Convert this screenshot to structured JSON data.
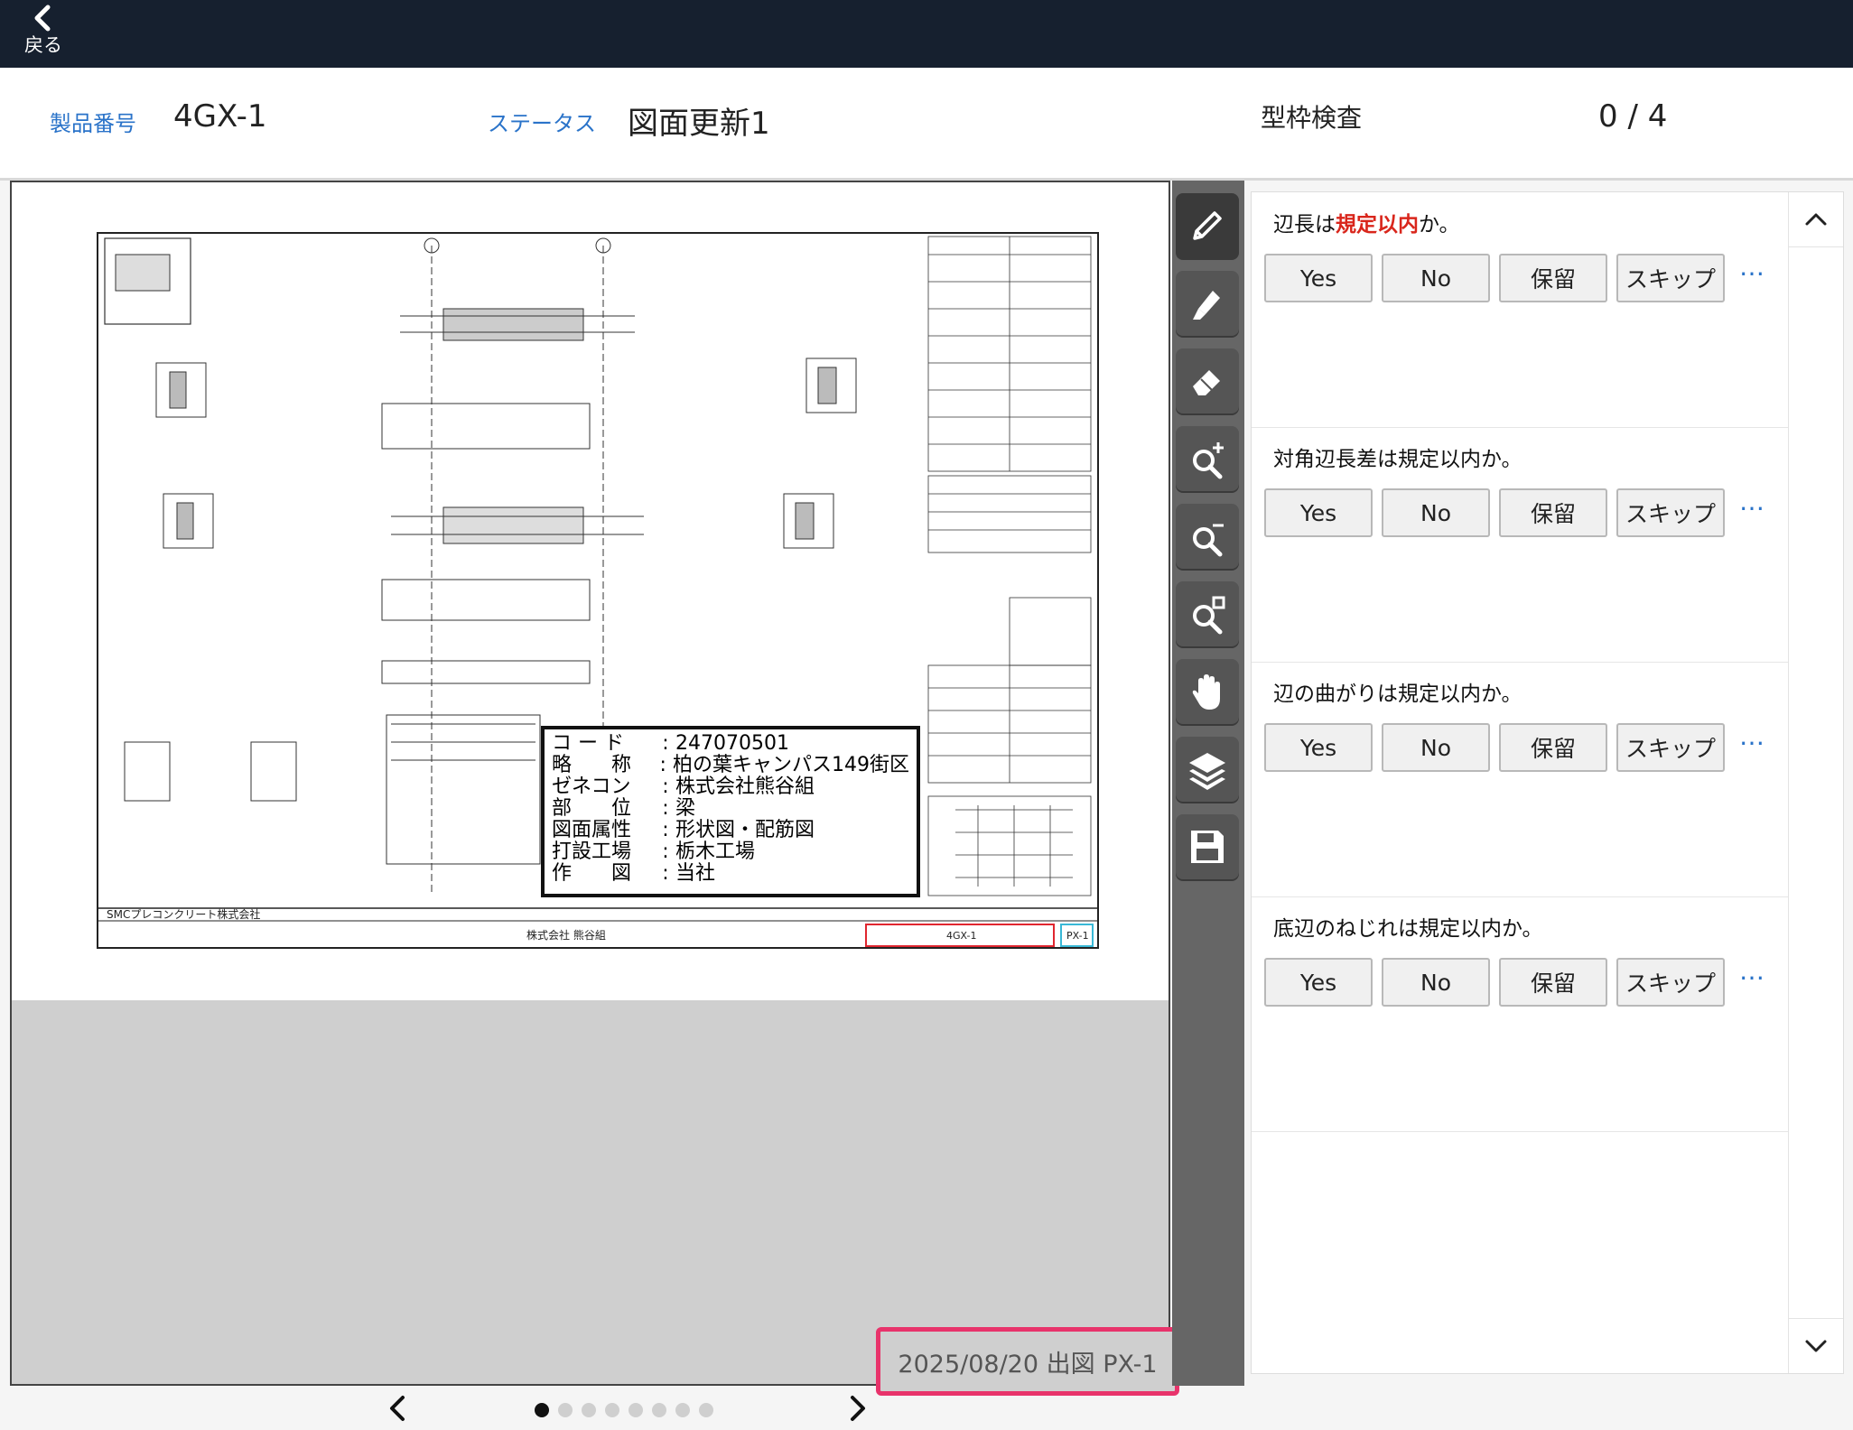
{
  "nav": {
    "back_label": "戻る"
  },
  "header": {
    "product_label": "製品番号",
    "product_value": "4GX-1",
    "status_label": "ステータス",
    "status_value": "図面更新1",
    "inspection_label": "型枠検査",
    "inspection_progress": "0 / 4"
  },
  "drawing": {
    "info": [
      {
        "key": "コ ー ド",
        "value": "247070501"
      },
      {
        "key": "略　　称",
        "value": "柏の葉キャンパス149街区"
      },
      {
        "key": "ゼネコン",
        "value": "株式会社熊谷組"
      },
      {
        "key": "部　　位",
        "value": "梁"
      },
      {
        "key": "図面属性",
        "value": "形状図・配筋図"
      },
      {
        "key": "打設工場",
        "value": "栃木工場"
      },
      {
        "key": "作　　図",
        "value": "当社"
      }
    ],
    "company_stamp": "SMCプレコンクリート株式会社",
    "contractor_stamp": "株式会社 熊谷組",
    "drawing_no": "4GX-1",
    "sheet_no": "PX-1",
    "issue_label": "2025/08/20 出図 PX-1"
  },
  "toolbar": {
    "tools": [
      "pencil-icon",
      "highlighter-icon",
      "eraser-icon",
      "zoom-in-icon",
      "zoom-out-icon",
      "zoom-fit-icon",
      "hand-icon",
      "layers-icon",
      "save-icon"
    ]
  },
  "pager": {
    "current_page": 1,
    "total_pages": 8
  },
  "checklist": {
    "buttons": {
      "yes": "Yes",
      "no": "No",
      "hold": "保留",
      "skip": "スキップ",
      "more": "…"
    },
    "items": [
      {
        "pre": "辺長は",
        "highlight": "規定以内",
        "post": "か。"
      },
      {
        "pre": "対角辺長差は規定以内か。",
        "highlight": "",
        "post": ""
      },
      {
        "pre": "辺の曲がりは規定以内か。",
        "highlight": "",
        "post": ""
      },
      {
        "pre": "底辺のねじれは規定以内か。",
        "highlight": "",
        "post": ""
      }
    ]
  },
  "colors": {
    "topbar": "#16202f",
    "label_blue": "#2a73c9",
    "highlight_red": "#d9261c",
    "date_border": "#e8336b"
  }
}
